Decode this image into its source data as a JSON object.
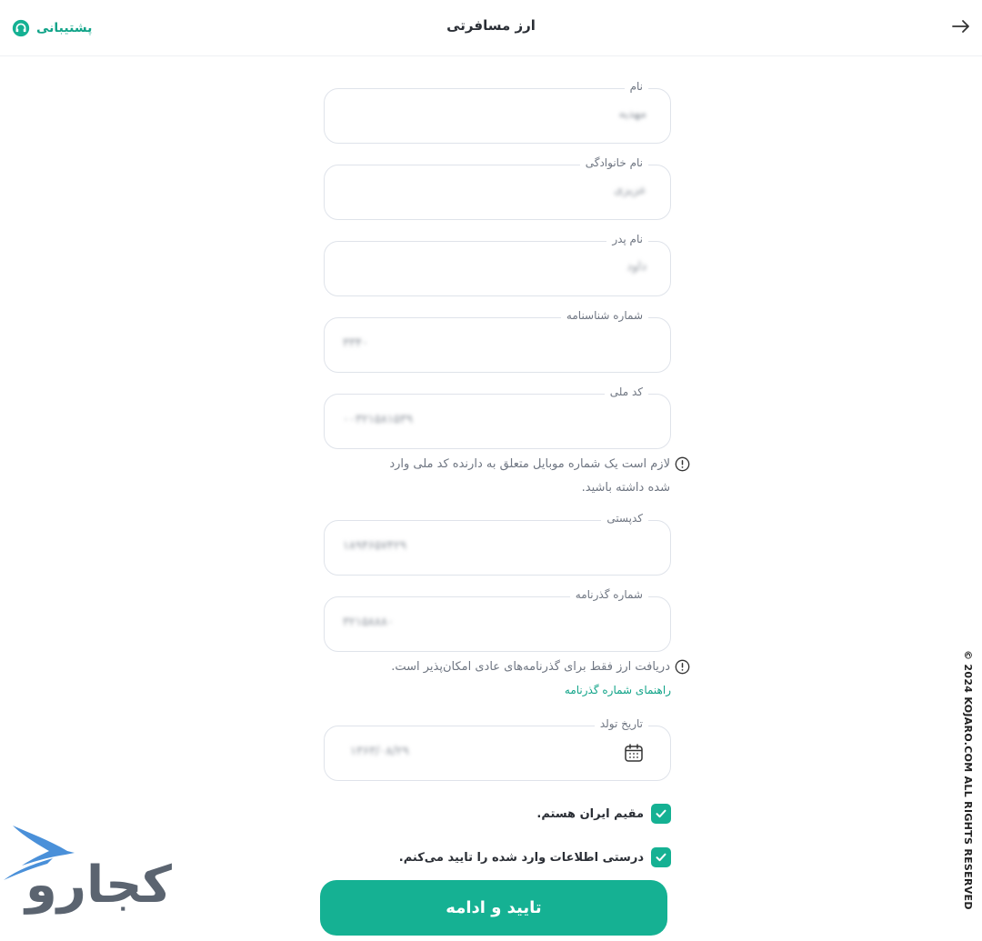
{
  "header": {
    "title": "ارز مسافرتی",
    "support_label": "پشتیبانی",
    "back_icon": "arrow-right-icon",
    "support_icon": "headset-icon"
  },
  "form": {
    "first_name": {
      "label": "نام",
      "value": "مهدیه"
    },
    "last_name": {
      "label": "نام خانوادگی",
      "value": "عزیزی"
    },
    "father_name": {
      "label": "نام پدر",
      "value": "داود"
    },
    "id_number": {
      "label": "شماره شناسنامه",
      "value": "۳۳۴۰"
    },
    "national_code": {
      "label": "کد ملی",
      "value": "۰۰۳۲۱۵۸۱۵۳۹"
    },
    "national_code_note_line1": "لازم است یک شماره موبایل متعلق به دارنده کد ملی وارد",
    "national_code_note_line2": "شده داشته باشید.",
    "postal_code": {
      "label": "کدپستی",
      "value": "۱۸۹۴۶۵۷۴۲۹"
    },
    "passport": {
      "label": "شماره گذرنامه",
      "value": "۳۲۱۵۸۸۸۰"
    },
    "passport_note": "دریافت ارز فقط برای گذرنامه‌های عادی امکان‌پذیر است.",
    "passport_guide_link": "راهنمای شماره گذرنامه",
    "birth_date": {
      "label": "تاریخ تولد",
      "value": "۱۳۶۳/۰۸/۲۹"
    },
    "resident_check": "مقیم ایران هستم.",
    "confirm_check": "درستی اطلاعات وارد شده را تایید می‌کنم.",
    "submit_label": "تایید و ادامه"
  },
  "footer": {
    "copyright": "© 2024 KOJARO.COM ALL RIGHTS RESERVED",
    "logo_text": "کجارو"
  },
  "colors": {
    "accent": "#15b193",
    "link": "#12a489",
    "border": "#dfe3ea",
    "logo_bird": "#4a90d9",
    "logo_text": "#5b6470"
  }
}
